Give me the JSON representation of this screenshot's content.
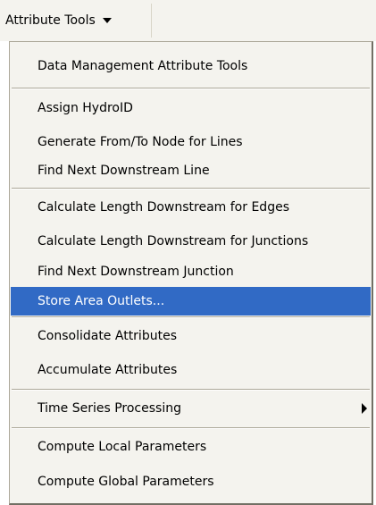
{
  "menu": {
    "title": "Attribute Tools",
    "items": [
      {
        "label": "Data Management Attribute Tools"
      },
      {
        "label": "Assign HydroID"
      },
      {
        "label": "Generate From/To Node for Lines"
      },
      {
        "label": "Find Next Downstream Line"
      },
      {
        "label": "Calculate Length Downstream for Edges"
      },
      {
        "label": "Calculate Length Downstream for Junctions"
      },
      {
        "label": "Find Next Downstream Junction"
      },
      {
        "label": "Store Area Outlets..."
      },
      {
        "label": "Consolidate Attributes"
      },
      {
        "label": "Accumulate Attributes"
      },
      {
        "label": "Time Series Processing"
      },
      {
        "label": "Compute Local Parameters"
      },
      {
        "label": "Compute Global Parameters"
      }
    ],
    "selected": "Store Area Outlets...",
    "submenu_item": "Time Series Processing"
  },
  "colors": {
    "menu_background": "#f4f3ee",
    "highlight": "#316ac5",
    "highlight_text": "#ffffff",
    "separator": "#aca899"
  }
}
